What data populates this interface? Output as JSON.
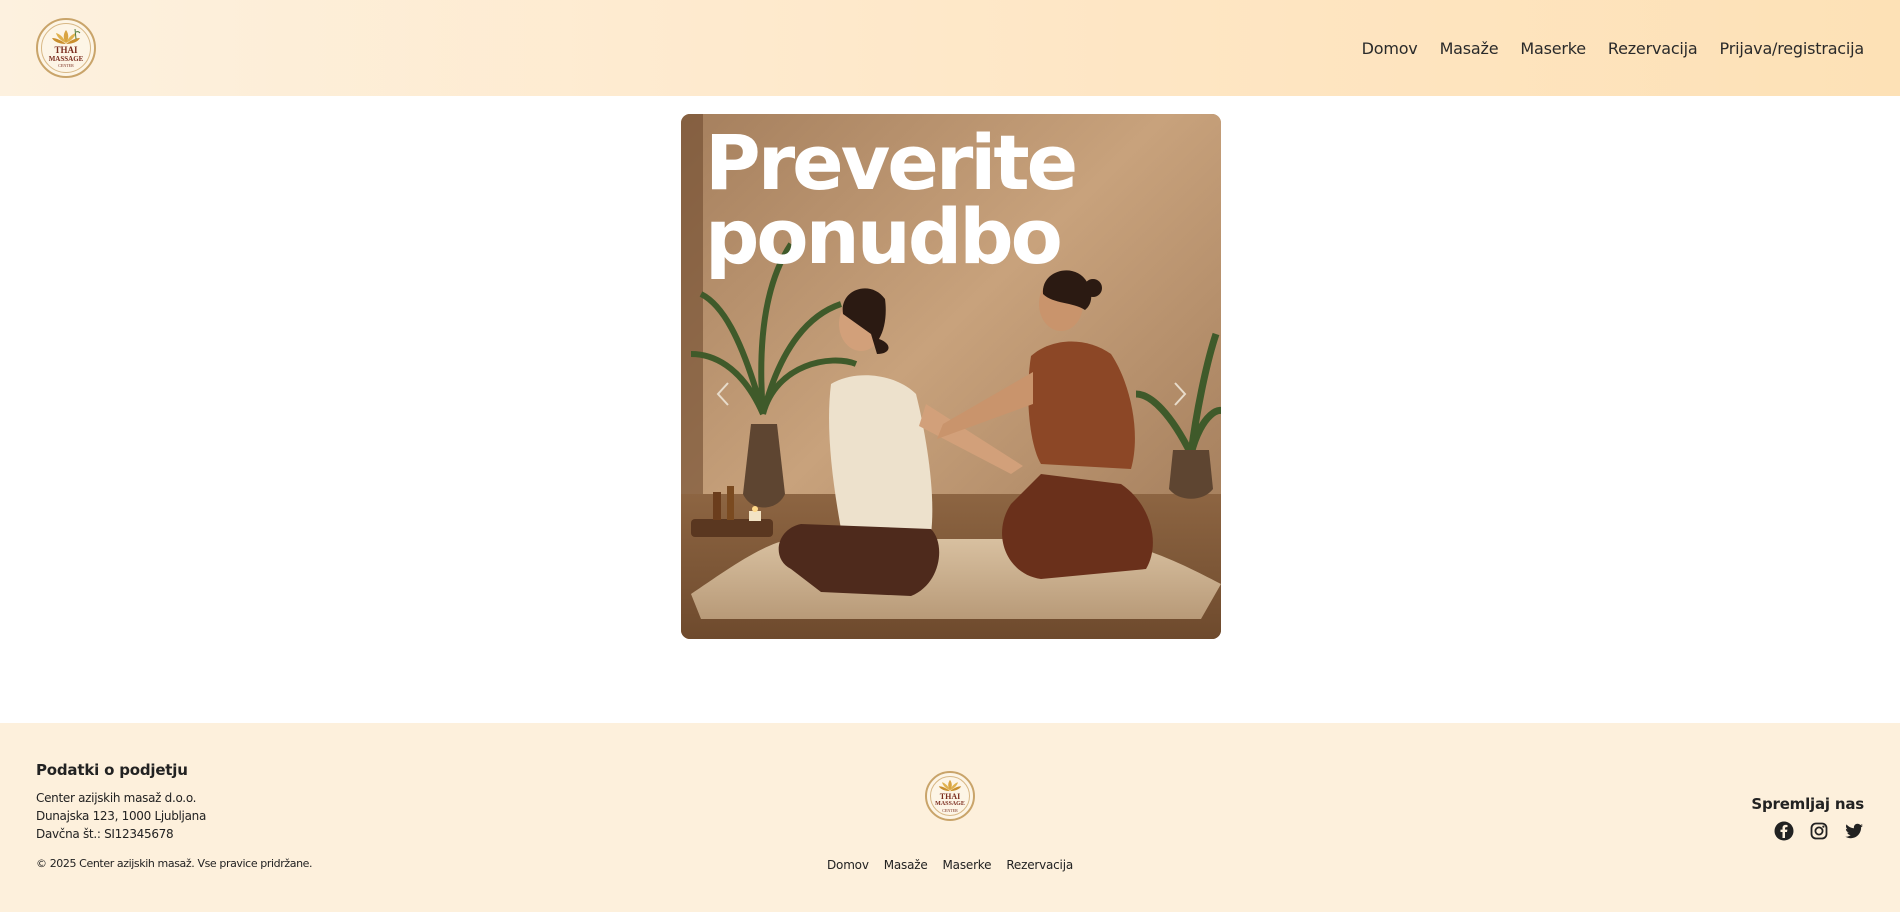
{
  "header": {
    "logo": {
      "line1": "THAI",
      "line2": "MASSAGE",
      "line3": "CENTER"
    },
    "nav": [
      {
        "label": "Domov"
      },
      {
        "label": "Masaže"
      },
      {
        "label": "Maserke"
      },
      {
        "label": "Rezervacija"
      },
      {
        "label": "Prijava/registracija"
      }
    ]
  },
  "hero": {
    "title": "Preverite\nponudbo",
    "prev_icon": "chevron-left-icon",
    "next_icon": "chevron-right-icon"
  },
  "footer": {
    "company": {
      "heading": "Podatki o podjetju",
      "name": "Center azijskih masaž d.o.o.",
      "address": "Dunajska 123, 1000 Ljubljana",
      "tax": "Davčna št.: SI12345678",
      "copyright": "© 2025 Center azijskih masaž. Vse pravice pridržane."
    },
    "logo": {
      "line1": "THAI",
      "line2": "MASSAGE",
      "line3": "CENTER"
    },
    "nav": [
      {
        "label": "Domov"
      },
      {
        "label": "Masaže"
      },
      {
        "label": "Maserke"
      },
      {
        "label": "Rezervacija"
      }
    ],
    "social": {
      "heading": "Spremljaj nas",
      "icons": [
        "facebook-icon",
        "instagram-icon",
        "twitter-icon"
      ]
    }
  },
  "colors": {
    "header_bg": "#fee6c4",
    "footer_bg": "#fdf0dc",
    "logo_text": "#7a2c1e"
  }
}
